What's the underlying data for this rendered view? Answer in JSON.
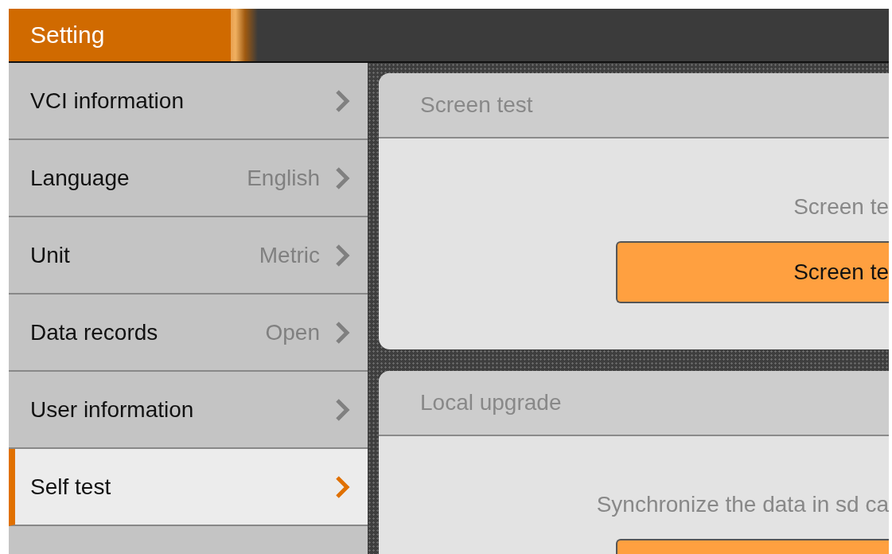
{
  "header": {
    "title": "Setting"
  },
  "sidebar": {
    "items": [
      {
        "label": "VCI information",
        "selected": false
      },
      {
        "label": "Language",
        "value": "English",
        "selected": false
      },
      {
        "label": "Unit",
        "value": "Metric",
        "selected": false
      },
      {
        "label": "Data records",
        "value": "Open",
        "selected": false
      },
      {
        "label": "User information",
        "selected": false
      },
      {
        "label": "Self test",
        "selected": true
      }
    ]
  },
  "cards": [
    {
      "kind": "action",
      "title": "Screen test",
      "description": "Screen te",
      "button_label": "Screen te"
    },
    {
      "kind": "action",
      "title": "Local upgrade",
      "description": "Synchronize the data in sd ca"
    }
  ]
}
